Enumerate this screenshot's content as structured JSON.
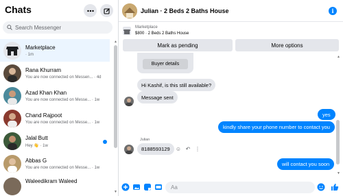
{
  "sidebar": {
    "title": "Chats",
    "search_placeholder": "Search Messenger",
    "chats": [
      {
        "name": "Marketplace",
        "sub": "· 1m",
        "active": true,
        "avatar_color": "#e4e6eb"
      },
      {
        "name": "Rana Khurram",
        "sub": "You are now connected on Messen... · 4d",
        "avatar_color": "#5a4a3c"
      },
      {
        "name": "Azad Khan Khan",
        "sub": "You are now connected on Messe... · 1w",
        "avatar_color": "#4b8a9c"
      },
      {
        "name": "Chand Rajpoot",
        "sub": "You are now connected on Messe... · 1w",
        "avatar_color": "#8a3a2e"
      },
      {
        "name": "Jalal Butt",
        "sub": "Hey 👋 · 1w",
        "unread": true,
        "avatar_color": "#3c5a3a"
      },
      {
        "name": "Abbas G",
        "sub": "You are now connected on Messe... · 1w",
        "avatar_color": "#b89a6a"
      },
      {
        "name": "Waleedikram Waleed",
        "sub": "",
        "avatar_color": "#7a6a5a"
      }
    ]
  },
  "header": {
    "title": "Julian · 2 Beds 2 Baths House"
  },
  "marketplace": {
    "label": "Marketplace",
    "product": "$800 · 2 Beds 2 Baths House",
    "mark_pending": "Mark as pending",
    "more_options": "More options"
  },
  "thread": {
    "buyer_details": "Buyer details",
    "msg_available": "Hi Kashif, is this still available?",
    "msg_sent": "Message sent",
    "msg_yes": "yes",
    "msg_share": "kindly share your phone number to contact you",
    "sender_julian": "Julian",
    "msg_phone": "8188593129",
    "msg_contact": "will contact you soon"
  },
  "composer": {
    "placeholder": "Aa"
  },
  "colors": {
    "accent": "#0084ff",
    "active_chat": "#ebf5ff",
    "incoming_bubble": "#e4e6eb"
  }
}
